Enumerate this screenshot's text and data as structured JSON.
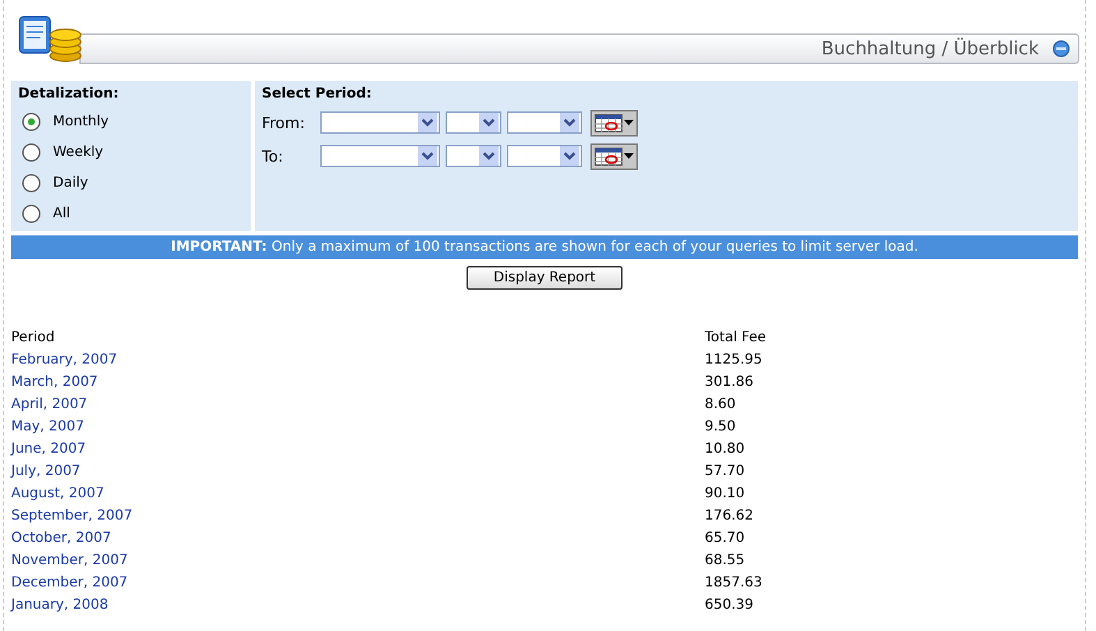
{
  "header": {
    "title": "Buchhaltung / Überblick"
  },
  "detalization": {
    "label": "Detalization:",
    "options": [
      {
        "label": "Monthly",
        "selected": true
      },
      {
        "label": "Weekly",
        "selected": false
      },
      {
        "label": "Daily",
        "selected": false
      },
      {
        "label": "All",
        "selected": false
      }
    ]
  },
  "period": {
    "label": "Select Period:",
    "rows": [
      {
        "label": "From:"
      },
      {
        "label": "To:"
      }
    ]
  },
  "notice": "**IMPORTANT:** Only a maximum of 100 transactions are shown for each of your queries to limit server load.",
  "button": "Display Report",
  "table": {
    "columns": [
      "Period",
      "Total Fee"
    ],
    "rows": [
      [
        "February, 2007",
        "1125.95"
      ],
      [
        "March, 2007",
        "301.86"
      ],
      [
        "April, 2007",
        "8.60"
      ],
      [
        "May, 2007",
        "9.50"
      ],
      [
        "June, 2007",
        "10.80"
      ],
      [
        "July, 2007",
        "57.70"
      ],
      [
        "August, 2007",
        "90.10"
      ],
      [
        "September, 2007",
        "176.62"
      ],
      [
        "October, 2007",
        "65.70"
      ],
      [
        "November, 2007",
        "68.55"
      ],
      [
        "December, 2007",
        "1857.63"
      ],
      [
        "January, 2008",
        "650.39"
      ]
    ]
  }
}
